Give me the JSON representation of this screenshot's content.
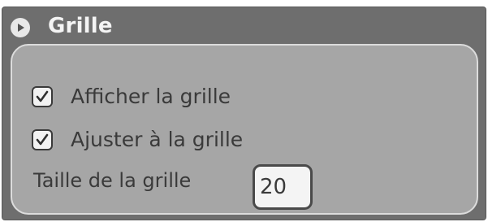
{
  "panel": {
    "title": "Grille",
    "toggle_icon": "play-triangle-icon",
    "options": [
      {
        "label": "Afficher la grille",
        "checked": true
      },
      {
        "label": "Ajuster à la grille",
        "checked": true
      }
    ],
    "grid_size": {
      "label": "Taille de la grille",
      "value": "20"
    }
  },
  "colors": {
    "header_bg": "#6e6e6e",
    "body_bg": "#a6a6a6",
    "body_border": "#dcdcdc",
    "text": "#3a3a3a",
    "title_text": "#f4f4f4"
  }
}
